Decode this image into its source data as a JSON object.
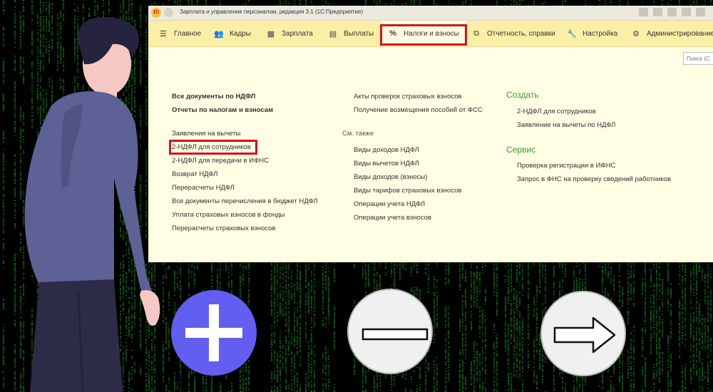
{
  "window": {
    "title": "Зарплата и управление персоналом, редакция 3.1  (1С:Предприятие)",
    "logo": "1С"
  },
  "menu": [
    {
      "label": "Главное",
      "icon": "hamburger-icon"
    },
    {
      "label": "Кадры",
      "icon": "people-icon"
    },
    {
      "label": "Зарплата",
      "icon": "calculator-icon"
    },
    {
      "label": "Выплаты",
      "icon": "wallet-icon"
    },
    {
      "label": "Налоги и взносы",
      "icon": "percent-icon",
      "active": true
    },
    {
      "label": "Отчетность, справки",
      "icon": "reports-icon"
    },
    {
      "label": "Настройка",
      "icon": "wrench-icon"
    },
    {
      "label": "Администрирование",
      "icon": "gear-icon"
    }
  ],
  "search": {
    "placeholder": "Поиск (C"
  },
  "col1": {
    "bold": [
      "Все документы по НДФЛ",
      "Отчеты по налогам и взносам"
    ],
    "links": [
      "Заявления на вычеты",
      "2-НДФЛ для сотрудников",
      "2-НДФЛ для передачи в ИФНС",
      "Возврат НДФЛ",
      "Перерасчеты НДФЛ",
      "Все документы перечисления в бюджет НДФЛ",
      "Уплата страховых взносов в фонды",
      "Перерасчеты страховых взносов"
    ]
  },
  "col2": {
    "top": [
      "Акты проверок страховых взносов",
      "Получение возмещения пособий от ФСС"
    ],
    "see_also_label": "См. также",
    "see_also": [
      "Виды доходов НДФЛ",
      "Виды вычетов НДФЛ",
      "Виды доходов (взносы)",
      "Виды тарифов страховых взносов",
      "Операции учета НДФЛ",
      "Операции учета взносов"
    ]
  },
  "col3": {
    "create_label": "Создать",
    "create": [
      "2-НДФЛ для сотрудников",
      "Заявление на вычеты по НДФЛ"
    ],
    "service_label": "Сервис",
    "service": [
      "Проверка регистрации в ИФНС",
      "Запрос в ФНС на проверку сведений работников"
    ]
  },
  "buttons": [
    "plus-icon",
    "minus-icon",
    "right-arrow-icon"
  ],
  "colors": {
    "menubar": "#fbeea6",
    "content_bg": "#fffde3",
    "highlight": "#d2131a",
    "section": "#3a9a3a",
    "plus_circle": "#625ef0",
    "matrix": "#22c832"
  }
}
